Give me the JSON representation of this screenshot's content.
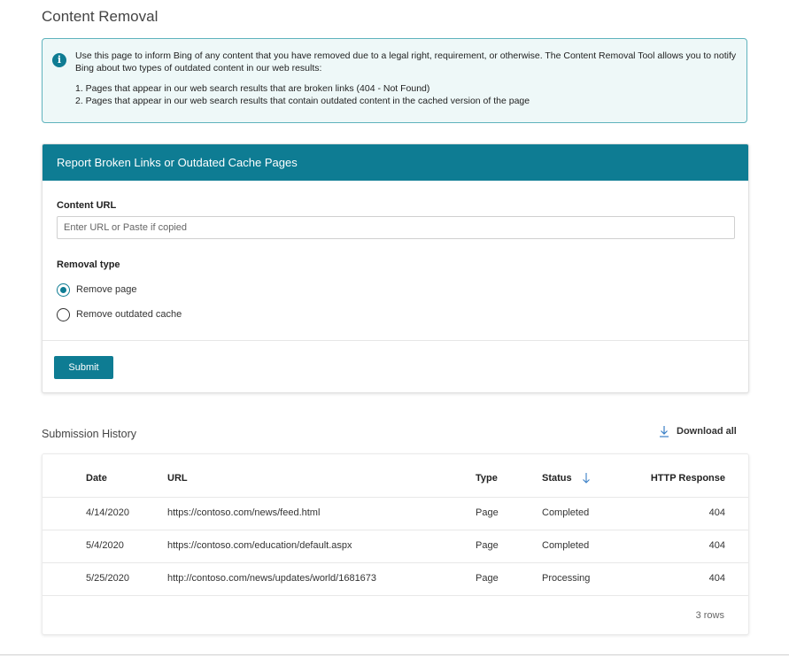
{
  "page": {
    "title": "Content Removal"
  },
  "info": {
    "paragraph": "Use this page to inform Bing of any content that you have removed due to a legal right, requirement, or otherwise. The Content Removal Tool allows you to notify Bing about two types of outdated content in our web results:",
    "items": [
      "1. Pages that appear in our web search results that are broken links (404 - Not Found)",
      "2. Pages that appear in our web search results that contain outdated content in the cached version of the page"
    ],
    "icon": "info-icon"
  },
  "form": {
    "header": "Report Broken Links or Outdated Cache Pages",
    "url_label": "Content URL",
    "url_value": "",
    "url_placeholder": "Enter URL or Paste if copied",
    "removal_label": "Removal type",
    "options": [
      {
        "label": "Remove page",
        "selected": true
      },
      {
        "label": "Remove outdated cache",
        "selected": false
      }
    ],
    "submit_label": "Submit"
  },
  "history": {
    "title": "Submission History",
    "download_label": "Download all",
    "columns": {
      "date": "Date",
      "url": "URL",
      "type": "Type",
      "status": "Status",
      "http": "HTTP Response"
    },
    "sort_column": "status",
    "rows": [
      {
        "date": "4/14/2020",
        "url": "https://contoso.com/news/feed.html",
        "type": "Page",
        "status": "Completed",
        "http": "404"
      },
      {
        "date": "5/4/2020",
        "url": "https://contoso.com/education/default.aspx",
        "type": "Page",
        "status": "Completed",
        "http": "404"
      },
      {
        "date": "5/25/2020",
        "url": "http://contoso.com/news/updates/world/1681673",
        "type": "Page",
        "status": "Processing",
        "http": "404"
      }
    ],
    "row_count": "3 rows"
  },
  "colors": {
    "accent": "#0e7c93",
    "info_bg": "#eef8f8",
    "info_border": "#5fb3bd"
  }
}
